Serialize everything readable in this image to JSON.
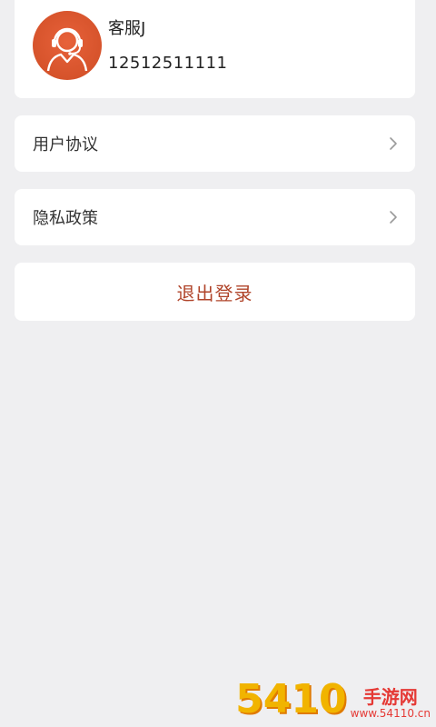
{
  "profile": {
    "name": "客服J",
    "phone": "12512511111",
    "avatar_icon": "customer-service-headset-icon",
    "avatar_color": "#d6532b"
  },
  "menu": {
    "items": [
      {
        "label": "用户协议",
        "icon": "chevron-right-icon"
      },
      {
        "label": "隐私政策",
        "icon": "chevron-right-icon"
      }
    ]
  },
  "logout": {
    "label": "退出登录",
    "color": "#b0442a"
  },
  "watermark": {
    "number": "5410",
    "name": "手游网",
    "domain": "www.54110.cn"
  },
  "colors": {
    "background": "#efeff1",
    "card": "#ffffff",
    "accent": "#d6532b"
  }
}
